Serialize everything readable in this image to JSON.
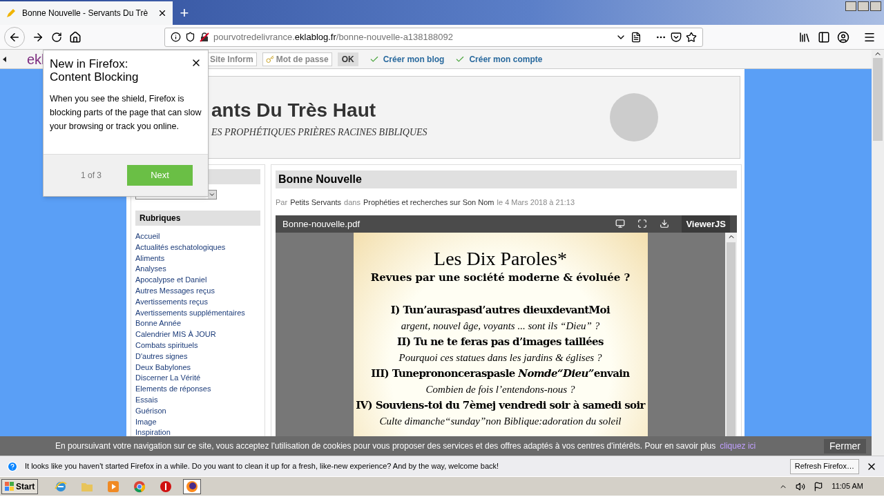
{
  "browser": {
    "tab": {
      "title": "Bonne Nouvelle - Servants Du Trè",
      "selected": true
    },
    "new_tab": "+",
    "url": {
      "prefix": "pourvotredelivrance.",
      "domain": "eklablog.fr",
      "path": "/bonne-nouvelle-a138188092"
    }
  },
  "site_toolbar": {
    "logo": "ekl",
    "items": [
      {
        "kind": "field",
        "text": "Site Inform"
      },
      {
        "kind": "field",
        "text": "Mot de passe"
      },
      {
        "kind": "button",
        "text": "OK"
      },
      {
        "kind": "link",
        "text": "Créer mon blog"
      },
      {
        "kind": "link",
        "text": "Créer mon compte"
      }
    ]
  },
  "popup": {
    "title_lines": [
      "New in Firefox:",
      "Content Blocking"
    ],
    "body": "When you see the shield, Firefox is blocking parts of the page that can slow your browsing or track you online.",
    "step": "1 of 3",
    "button": "Next"
  },
  "header": {
    "title": "ants Du Très Haut",
    "subtitle": "ES PROPHÉTIQUES PRIÈRES RACINES BIBLIQUES"
  },
  "sidebar": {
    "heading": "Rubriques",
    "links": [
      "Accueil",
      "Actualités eschatologiques",
      "Aliments",
      "Analyses",
      "Apocalypse et Daniel",
      "Autres Messages reçus",
      "Avertissements reçus",
      "Avertissements supplémentaires",
      "Bonne Année",
      "Calendrier MIS À JOUR",
      "Combats spirituels",
      "D'autres signes",
      "Deux Babylones",
      "Discerner La Vérité",
      "Elements de réponses",
      "Essais",
      "Guérison",
      "Image",
      "Inspiration"
    ]
  },
  "article": {
    "title": "Bonne Nouvelle",
    "byline": [
      {
        "kind": "text",
        "text": "Par"
      },
      {
        "kind": "link",
        "text": "Petits Servants"
      },
      {
        "kind": "text",
        "text": "dans"
      },
      {
        "kind": "link",
        "text": "Prophéties et recherches sur Son Nom"
      },
      {
        "kind": "text",
        "text": "le 4 Mars 2018 à 21:13"
      }
    ]
  },
  "pdf_viewer": {
    "filename": "Bonne-nouvelle.pdf",
    "brand": "ViewerJS",
    "lines": [
      {
        "kind": "title",
        "text": "Les Dix Paroles*"
      },
      {
        "kind": "subtitle",
        "text": "Revues par une société moderne & évoluée ?"
      },
      {
        "kind": "rule",
        "text": "I) Tun’auraspasd’autres dieuxdevantMoi"
      },
      {
        "kind": "comment",
        "text": "argent, nouvel âge, voyants ... sont ils “Dieu” ?"
      },
      {
        "kind": "rule",
        "text": "II) Tu ne te feras pas d’images taillées"
      },
      {
        "kind": "comment",
        "text": "Pourquoi ces statues dans les jardins & églises ?"
      },
      {
        "kind": "mixed_rule",
        "parts": [
          {
            "text": "III) Tuneprononceraspasle ",
            "italic": false
          },
          {
            "text": "Nomde“Dieu”",
            "italic": true
          },
          {
            "text": "envain",
            "italic": false
          }
        ]
      },
      {
        "kind": "comment",
        "text": "Combien de fois l’entendons-nous ?"
      },
      {
        "kind": "rule",
        "text": "IV) Souviens-toi du 7èmej vendredi soir à samedi soir"
      },
      {
        "kind": "comment",
        "text": "Culte dimanche“sunday”non Biblique:adoration du soleil"
      }
    ]
  },
  "cookie_banner": {
    "text": "En poursuivant votre navigation sur ce site, vous acceptez l'utilisation de cookies pour vous proposer des services et des offres adaptés à vos centres d'intérêts. Pour en savoir plus",
    "link": "cliquez ici",
    "button": "Fermer"
  },
  "notification": {
    "text": "It looks like you haven't started Firefox in a while. Do you want to clean it up for a fresh, like-new experience? And by the way, welcome back!",
    "button": "Refresh Firefox…"
  },
  "taskbar": {
    "start": "Start",
    "apps": [
      {
        "kind": "ie",
        "selected": false
      },
      {
        "kind": "folder",
        "selected": false
      },
      {
        "kind": "media",
        "selected": false
      },
      {
        "kind": "chrome",
        "selected": false
      },
      {
        "kind": "stop",
        "selected": false
      },
      {
        "kind": "firefox",
        "selected": true
      }
    ],
    "clock": "11:05 AM"
  }
}
